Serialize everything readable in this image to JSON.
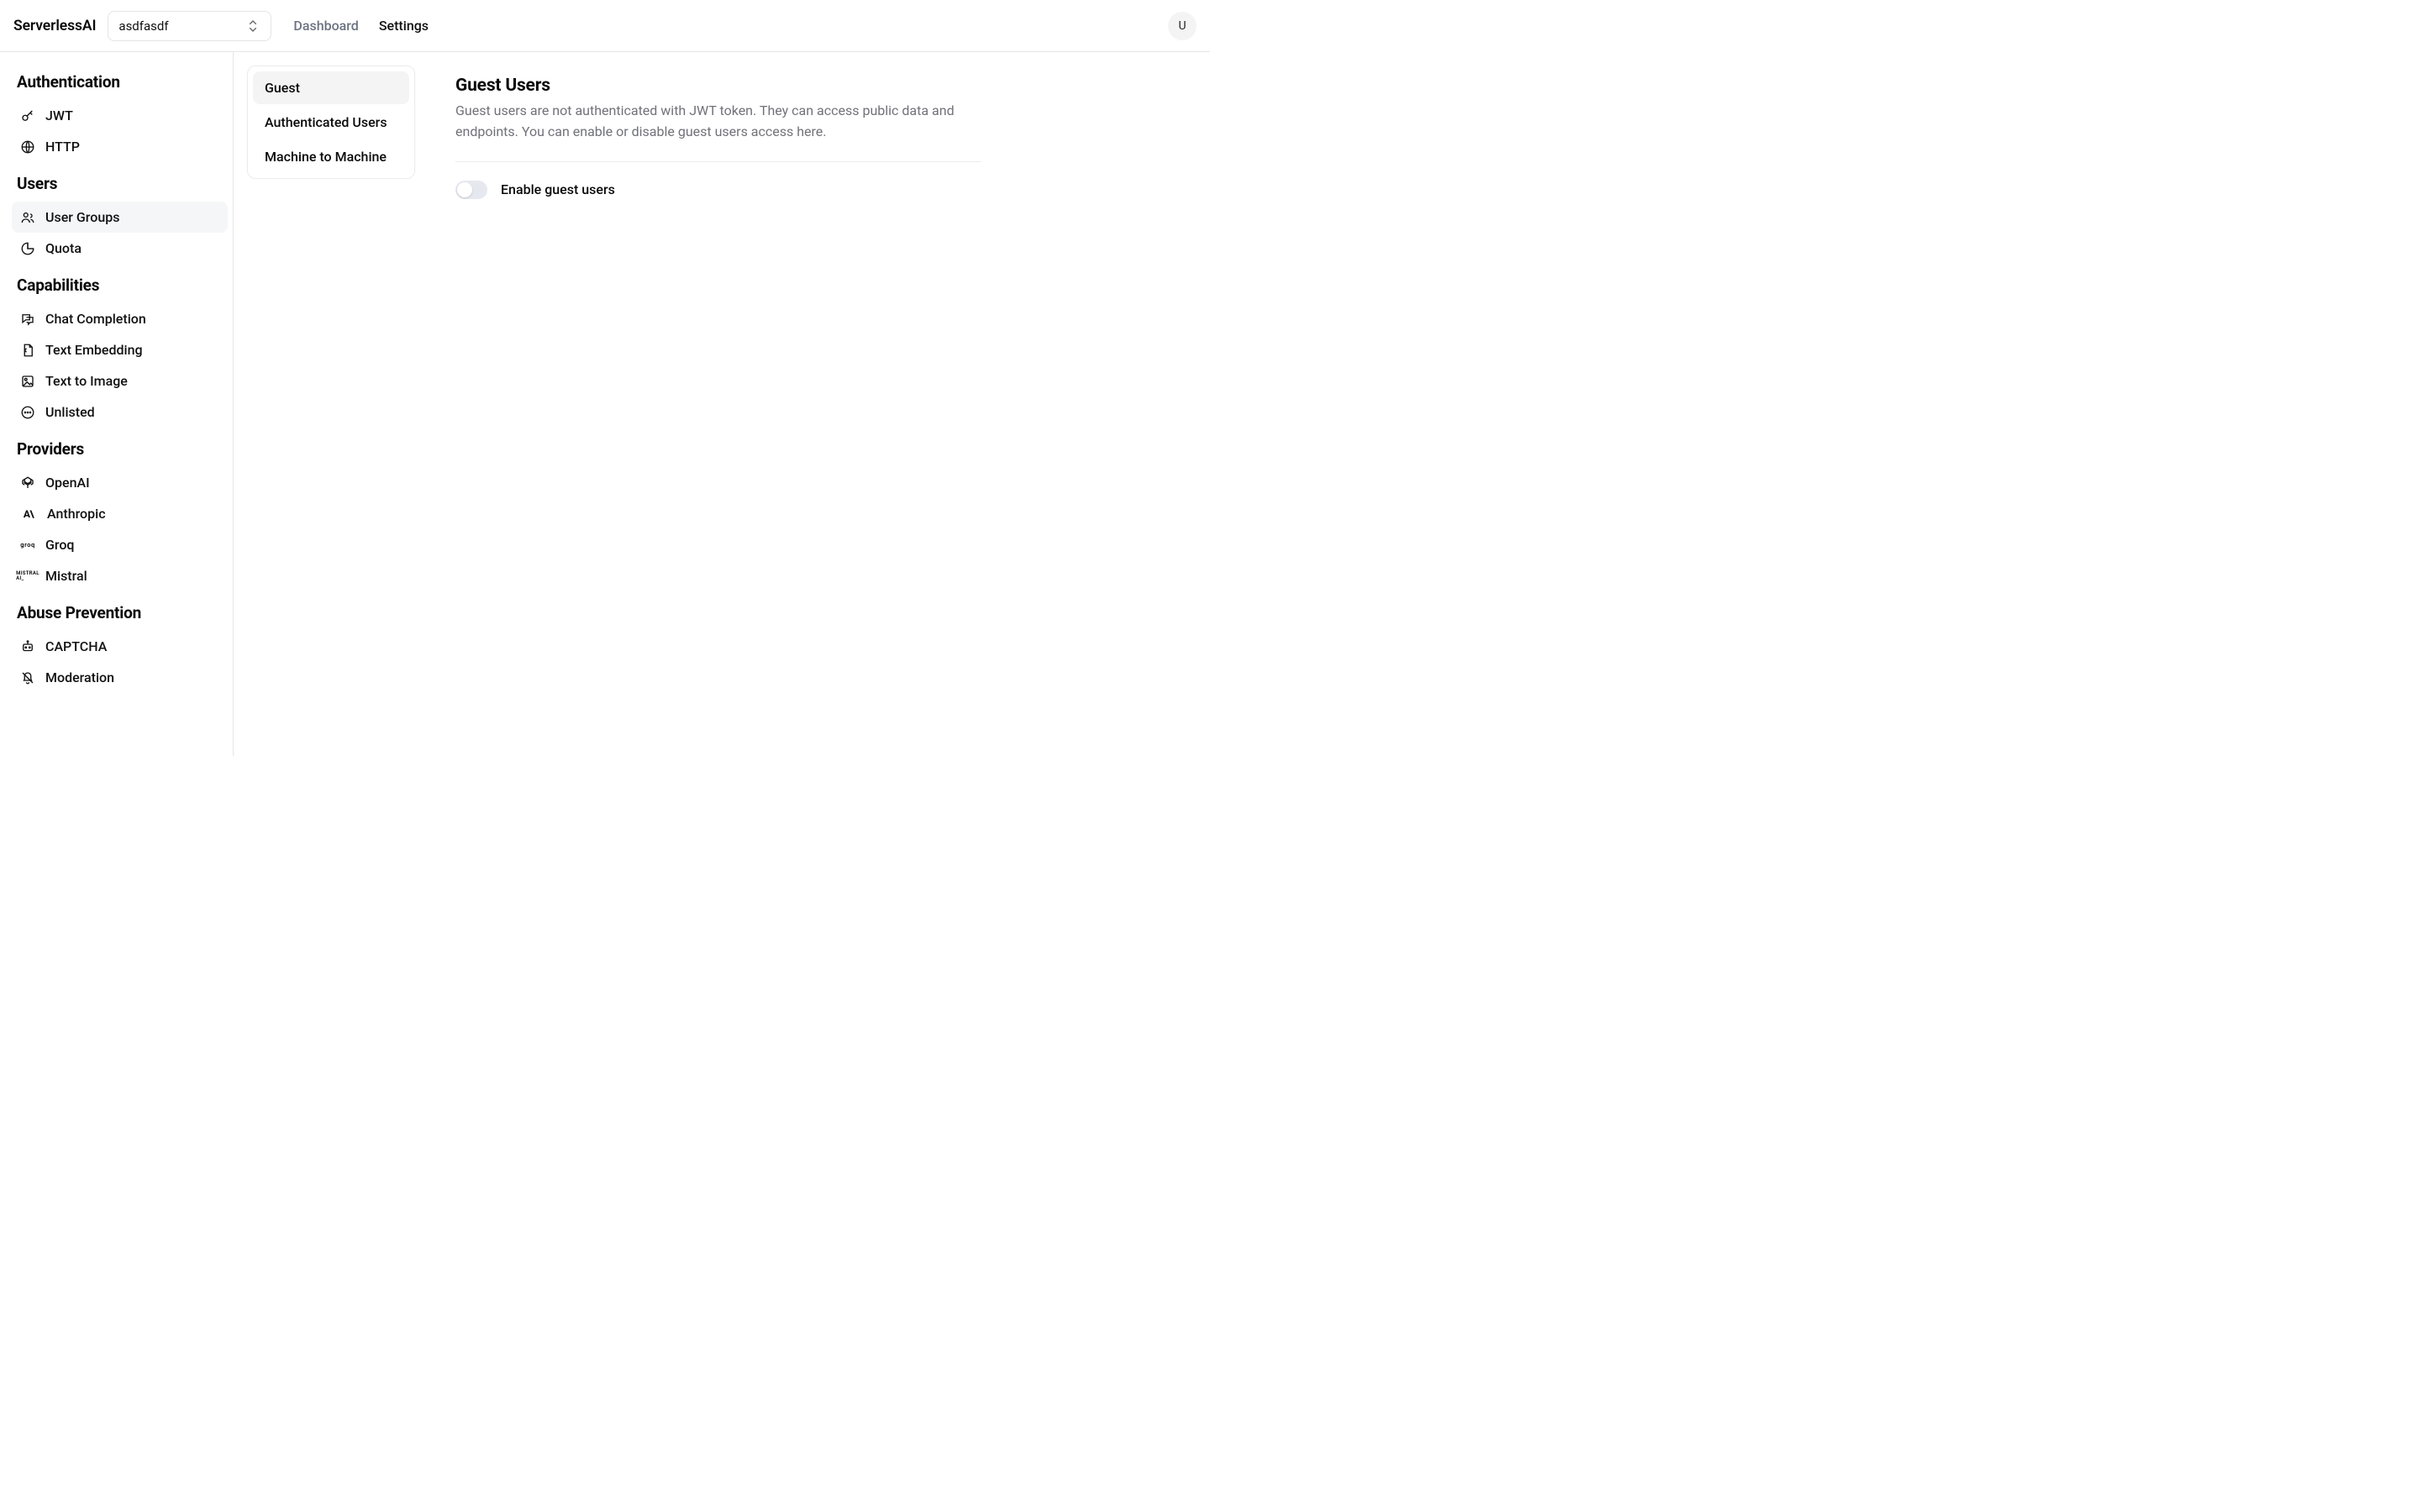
{
  "header": {
    "brand": "ServerlessAI",
    "project_selected": "asdfasdf",
    "nav_dashboard": "Dashboard",
    "nav_settings": "Settings",
    "avatar_initial": "U"
  },
  "sidebar": {
    "sections": [
      {
        "title": "Authentication",
        "items": [
          {
            "name": "jwt",
            "label": "JWT"
          },
          {
            "name": "http",
            "label": "HTTP"
          }
        ]
      },
      {
        "title": "Users",
        "items": [
          {
            "name": "user-groups",
            "label": "User Groups",
            "active": true
          },
          {
            "name": "quota",
            "label": "Quota"
          }
        ]
      },
      {
        "title": "Capabilities",
        "items": [
          {
            "name": "chat-completion",
            "label": "Chat Completion"
          },
          {
            "name": "text-embedding",
            "label": "Text Embedding"
          },
          {
            "name": "text-to-image",
            "label": "Text to Image"
          },
          {
            "name": "unlisted",
            "label": "Unlisted"
          }
        ]
      },
      {
        "title": "Providers",
        "items": [
          {
            "name": "openai",
            "label": "OpenAI"
          },
          {
            "name": "anthropic",
            "label": "Anthropic"
          },
          {
            "name": "groq",
            "label": "Groq"
          },
          {
            "name": "mistral",
            "label": "Mistral"
          }
        ]
      },
      {
        "title": "Abuse Prevention",
        "items": [
          {
            "name": "captcha",
            "label": "CAPTCHA"
          },
          {
            "name": "moderation",
            "label": "Moderation"
          }
        ]
      }
    ]
  },
  "middle_tabs": {
    "items": [
      {
        "name": "guest",
        "label": "Guest",
        "active": true
      },
      {
        "name": "authenticated-users",
        "label": "Authenticated Users"
      },
      {
        "name": "machine-to-machine",
        "label": "Machine to Machine"
      }
    ]
  },
  "main": {
    "title": "Guest Users",
    "description": "Guest users are not authenticated with JWT token. They can access public data and endpoints. You can enable or disable guest users access here.",
    "toggle_label": "Enable guest users",
    "toggle_enabled": false
  }
}
